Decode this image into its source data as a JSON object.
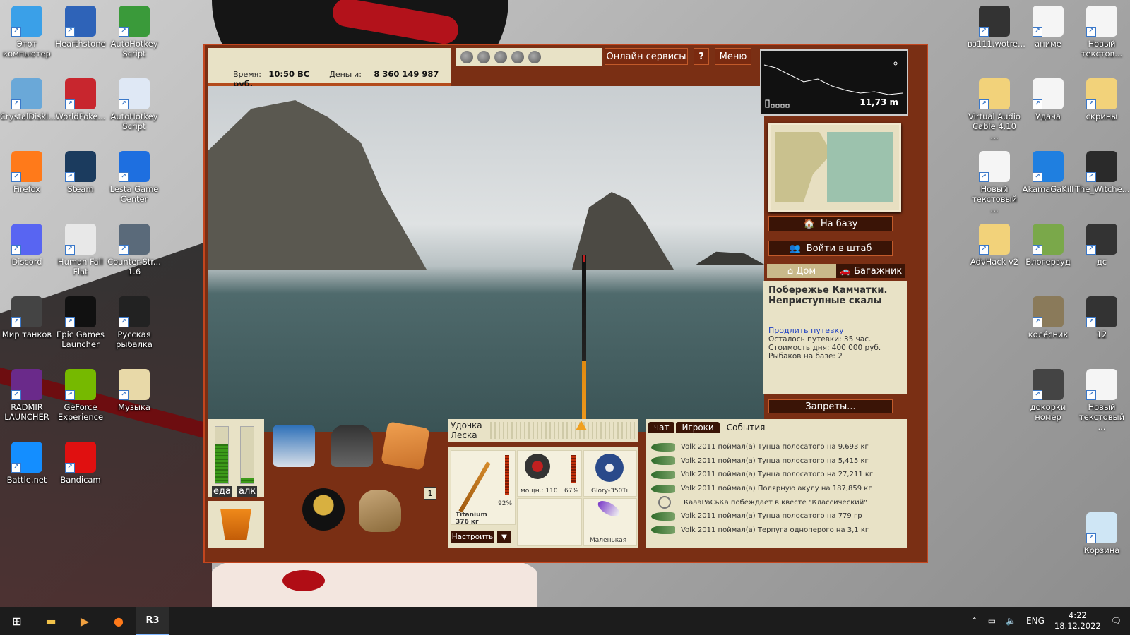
{
  "desktop": {
    "left_icons": [
      {
        "label": "Этот компьютер",
        "icon": "computer-icon",
        "color": "#3aa0e8"
      },
      {
        "label": "Hearthstone",
        "icon": "hearthstone-icon",
        "color": "#2e63b8"
      },
      {
        "label": "AutoHotkey Script",
        "icon": "autohotkey-icon",
        "color": "#3a9a3a"
      },
      {
        "label": "CrystalDiskI...",
        "icon": "crystaldisk-icon",
        "color": "#6aa8d8"
      },
      {
        "label": "WorldPoke...",
        "icon": "poker-icon",
        "color": "#c8262e"
      },
      {
        "label": "AutoHotkey Script",
        "icon": "ahk-script-icon",
        "color": "#dfe8f5"
      },
      {
        "label": "Firefox",
        "icon": "firefox-icon",
        "color": "#ff7a1a"
      },
      {
        "label": "Steam",
        "icon": "steam-icon",
        "color": "#1b3b5e"
      },
      {
        "label": "Lesta Game Center",
        "icon": "lesta-icon",
        "color": "#1e6fe0"
      },
      {
        "label": "Discord",
        "icon": "discord-icon",
        "color": "#5865f2"
      },
      {
        "label": "Human Fall Flat",
        "icon": "humanfallflat-icon",
        "color": "#e8e8e8"
      },
      {
        "label": "Counter-Str... 1.6",
        "icon": "counterstrike-icon",
        "color": "#5a6a7a"
      },
      {
        "label": "Мир танков",
        "icon": "tanks-icon",
        "color": "#444"
      },
      {
        "label": "Epic Games Launcher",
        "icon": "epic-icon",
        "color": "#111"
      },
      {
        "label": "Русская рыбалка",
        "icon": "rr3-icon",
        "color": "#222"
      },
      {
        "label": "RADMIR LAUNCHER",
        "icon": "radmir-icon",
        "color": "#6a2a8a"
      },
      {
        "label": "GeForce Experience",
        "icon": "geforce-icon",
        "color": "#76b900"
      },
      {
        "label": "Музыка",
        "icon": "music-icon",
        "color": "#e8d9a8"
      },
      {
        "label": "Battle.net",
        "icon": "battlenet-icon",
        "color": "#148eff"
      },
      {
        "label": "Bandicam",
        "icon": "bandicam-icon",
        "color": "#e01010"
      }
    ],
    "right_icons": [
      {
        "label": "вз111.wotre...",
        "icon": "wot-replay-icon",
        "color": "#333"
      },
      {
        "label": "аниме",
        "icon": "text-file-icon",
        "color": "#f5f5f5"
      },
      {
        "label": "Новый текстов...",
        "icon": "text-file-icon",
        "color": "#f5f5f5"
      },
      {
        "label": "Virtual Audio Cable 4.10 ...",
        "icon": "folder-icon",
        "color": "#f2d27a"
      },
      {
        "label": "Удача",
        "icon": "text-file-icon",
        "color": "#f5f5f5"
      },
      {
        "label": "скрины",
        "icon": "folder-icon",
        "color": "#f2d27a"
      },
      {
        "label": "Новый текстовый ...",
        "icon": "text-file-icon",
        "color": "#f5f5f5"
      },
      {
        "label": "AkamaGaKill",
        "icon": "window-icon",
        "color": "#1f7fe0"
      },
      {
        "label": "The_Witche...",
        "icon": "image-icon",
        "color": "#2a2a2a"
      },
      {
        "label": "AdvHack v2",
        "icon": "folder-icon",
        "color": "#f2d27a"
      },
      {
        "label": "Блогерзуд",
        "icon": "image-icon",
        "color": "#7aa84a"
      },
      {
        "label": "дс",
        "icon": "image-icon",
        "color": "#333"
      },
      {
        "label": "колёсник",
        "icon": "image-icon",
        "color": "#8a7a5a"
      },
      {
        "label": "12",
        "icon": "image-icon",
        "color": "#333"
      },
      {
        "label": "докорки номер",
        "icon": "image-icon",
        "color": "#444"
      },
      {
        "label": "Новый текстовый ...",
        "icon": "text-file-icon",
        "color": "#f5f5f5"
      },
      {
        "label": "Корзина",
        "icon": "recycle-bin-icon",
        "color": "#cfe6f5"
      }
    ]
  },
  "game": {
    "time_label": "Время:",
    "time_value": "10:50 ВС",
    "money_label": "Деньги:",
    "money_value": "8 360 149 987 руб.",
    "online_services": "Онлайн сервисы",
    "help": "?",
    "menu": "Меню",
    "depth": "11,73 m",
    "to_base": "На базу",
    "enter_hq": "Войти в штаб",
    "home": "Дом",
    "trunk": "Багажник",
    "location_title": "Побережье Камчатки. Неприступные скалы",
    "extend_trip": "Продлить путевку",
    "trip_left": "Осталось путевки: 35 час.",
    "day_cost": "Стоимость дня: 400 000 руб.",
    "fishers": "Рыбаков на базе: 2",
    "bans": "Запреты...",
    "food": "еда",
    "alc": "алк",
    "food_level": 0.7,
    "alc_level": 0.1,
    "inv_count": "1",
    "rod_label": "Удочка",
    "line_label": "Леска",
    "tension": 0.63,
    "rod_pct": "92%",
    "rod_name": "Titanium",
    "rod_load": "376 кг",
    "reel_power": "мощн.: 110",
    "reel_pct": "67%",
    "line_name": "Glory-350Ti",
    "lure_name": "Маленькая",
    "setup": "Настроить",
    "setup_arrow": "▼",
    "tabs": [
      "чат",
      "Игроки",
      "События"
    ],
    "events": [
      {
        "type": "fish",
        "text": "Volk 2011 поймал(а) Тунца полосатого на 9,693 кг"
      },
      {
        "type": "fish",
        "text": "Volk 2011 поймал(а) Тунца полосатого на 5,415 кг"
      },
      {
        "type": "fish",
        "text": "Volk 2011 поймал(а) Тунца полосатого на 27,211 кг"
      },
      {
        "type": "fish",
        "text": "Volk 2011 поймал(а) Полярную акулу на 187,859 кг"
      },
      {
        "type": "quest",
        "text": "КаааРаСьКа побеждает в квесте \"Классический\""
      },
      {
        "type": "fish",
        "text": "Volk 2011 поймал(а) Тунца полосатого на 779 гр"
      },
      {
        "type": "fish",
        "text": "Volk 2011 поймал(а) Терпуга одноперого на 3,1 кг"
      }
    ]
  },
  "taskbar": {
    "lang": "ENG",
    "time": "4:22",
    "date": "18.12.2022"
  }
}
